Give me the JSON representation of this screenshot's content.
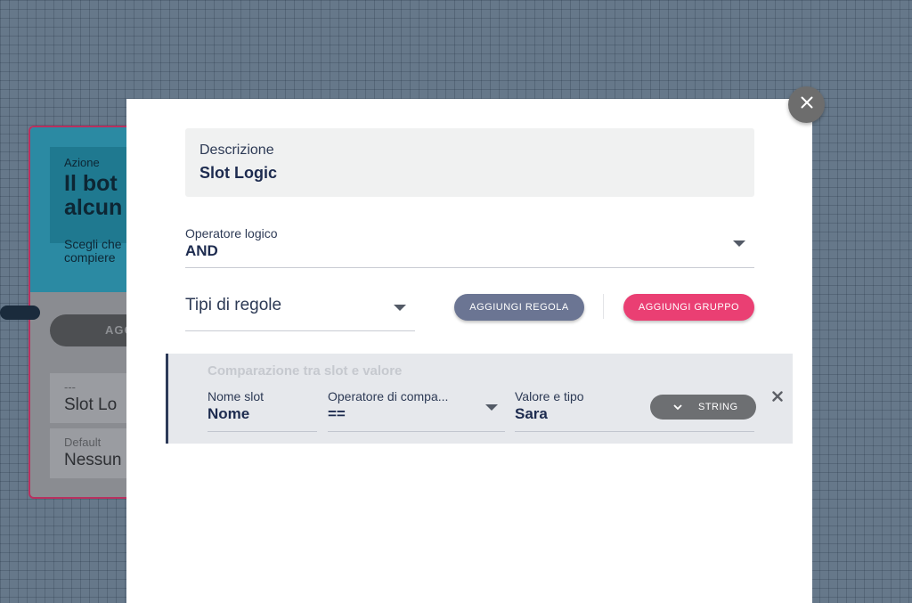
{
  "background_node": {
    "type_label": "Azione",
    "title_line1": "Il bot",
    "title_line2": "alcun",
    "desc_line1": "Scegli che",
    "desc_line2": "compiere",
    "add_button": "AGG",
    "field1_label": "---",
    "field1_value": "Slot Lo",
    "field2_label": "Default",
    "field2_value": "Nessun"
  },
  "modal": {
    "close_icon": "close-icon",
    "description": {
      "label": "Descrizione",
      "value": "Slot Logic"
    },
    "logical_operator": {
      "label": "Operatore logico",
      "value": "AND"
    },
    "rule_types": {
      "label": "Tipi di regole"
    },
    "buttons": {
      "add_rule": "AGGIUNGI REGOLA",
      "add_group": "AGGIUNGI GRUPPO"
    },
    "rule": {
      "title": "Comparazione tra slot e valore",
      "slot_name": {
        "label": "Nome slot",
        "value": "Nome"
      },
      "comparison_operator": {
        "label": "Operatore di compa...",
        "value": "=="
      },
      "value_and_type": {
        "label": "Valore e tipo",
        "value": "Sara"
      },
      "type_button": "STRING"
    }
  },
  "colors": {
    "accent_pink": "#ea3f73",
    "button_slate": "#6b7593",
    "text_navy": "#1d2b4f"
  }
}
